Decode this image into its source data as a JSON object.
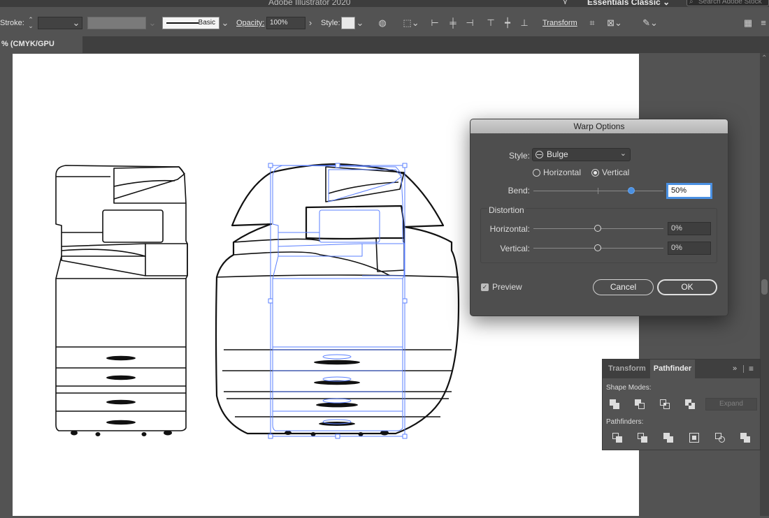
{
  "app": {
    "title": "Adobe Illustrator 2020",
    "workspace": "Essentials Classic",
    "search_placeholder": "Search Adobe Stock"
  },
  "controlbar": {
    "stroke_label": "Stroke:",
    "brush_name": "Basic",
    "opacity_label": "Opacity:",
    "opacity_value": "100%",
    "style_label": "Style:",
    "transform_label": "Transform"
  },
  "document": {
    "tab_label": "% (CMYK/GPU Preview)"
  },
  "warp_dialog": {
    "title": "Warp Options",
    "style_label": "Style:",
    "style_value": "Bulge",
    "horizontal_label": "Horizontal",
    "vertical_label": "Vertical",
    "orientation_selected": "vertical",
    "bend_label": "Bend:",
    "bend_value": "50%",
    "bend_fraction": 0.75,
    "distortion_label": "Distortion",
    "dist_horizontal_label": "Horizontal:",
    "dist_horizontal_value": "0%",
    "dist_vertical_label": "Vertical:",
    "dist_vertical_value": "0%",
    "preview_label": "Preview",
    "preview_checked": true,
    "cancel_label": "Cancel",
    "ok_label": "OK"
  },
  "pathfinder_panel": {
    "tab_transform": "Transform",
    "tab_pathfinder": "Pathfinder",
    "shape_modes_label": "Shape Modes:",
    "expand_label": "Expand",
    "pathfinders_label": "Pathfinders:"
  },
  "colors": {
    "accent": "#4a90e2",
    "selection": "#5a7fff",
    "dialog_bg": "#4e4e4e"
  }
}
